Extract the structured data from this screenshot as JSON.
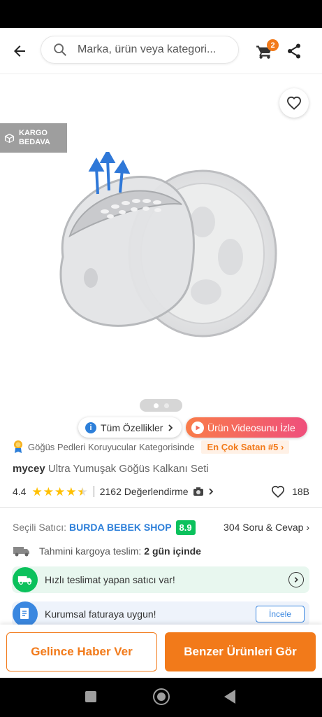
{
  "header": {
    "search_placeholder": "Marka, ürün veya kategori...",
    "cart_count": "2"
  },
  "gallery": {
    "free_shipping_line1": "KARGO",
    "free_shipping_line2": "BEDAVA",
    "image_count": 2,
    "active_image": 1
  },
  "actions": {
    "all_features": "Tüm Özellikler",
    "watch_video": "Ürün Videosunu İzle"
  },
  "category": {
    "text": "Göğüs Pedleri Koruyucular Kategorisinde",
    "rank_badge": "En Çok Satan #5"
  },
  "product": {
    "brand": "mycey",
    "name": "Ultra Yumuşak Göğüs Kalkanı Seti",
    "rating": "4.4",
    "rating_value": 4.4,
    "reviews": "2162 Değerlendirme",
    "favorites": "18B"
  },
  "seller": {
    "label": "Seçili Satıcı:",
    "name": "BURDA BEBEK SHOP",
    "score": "8.9",
    "qa": "304 Soru & Cevap"
  },
  "delivery": {
    "label": "Tahmini kargoya teslim:",
    "value": "2 gün içinde"
  },
  "info_cards": {
    "fast_delivery": "Hızlı teslimat yapan satıcı var!",
    "invoice": "Kurumsal faturaya uygun!",
    "invoice_button": "İncele"
  },
  "bottom": {
    "notify": "Gelince Haber Ver",
    "similar": "Benzer Ürünleri Gör"
  },
  "colors": {
    "accent": "#f27a1a",
    "success": "#0bc15c",
    "link": "#2d7fd9"
  }
}
